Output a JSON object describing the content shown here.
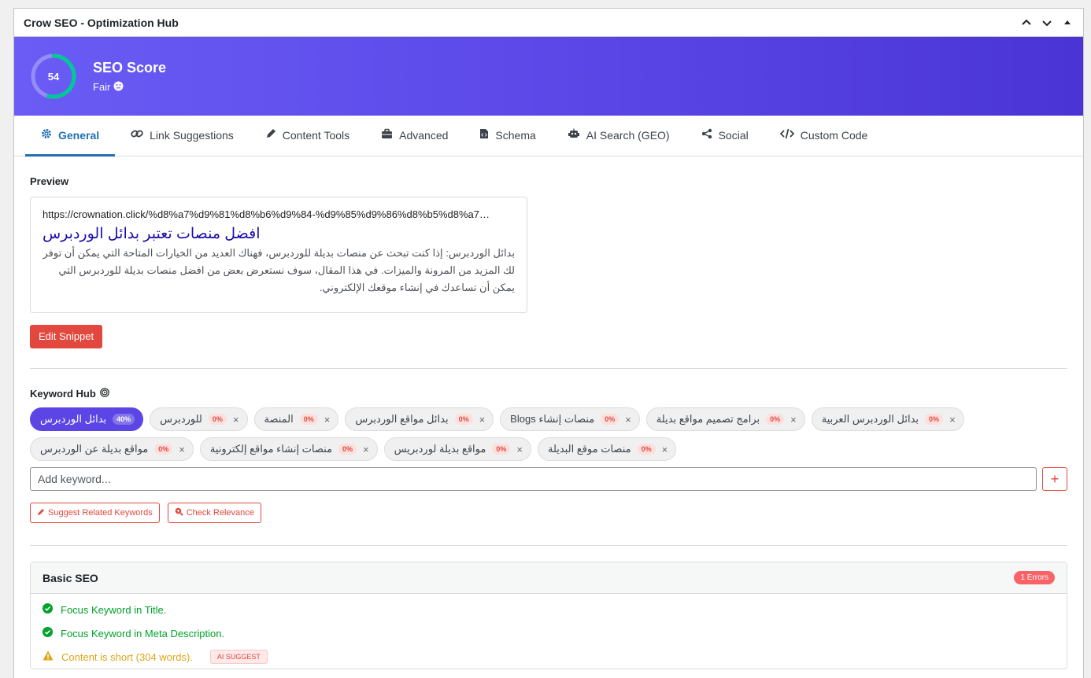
{
  "panel": {
    "title": "Crow SEO - Optimization Hub"
  },
  "score": {
    "value": "54",
    "title": "SEO Score",
    "status": "Fair",
    "percent": 54
  },
  "tabs": [
    {
      "label": "General",
      "icon": "gear-icon"
    },
    {
      "label": "Link Suggestions",
      "icon": "link-icon"
    },
    {
      "label": "Content Tools",
      "icon": "pen-icon"
    },
    {
      "label": "Advanced",
      "icon": "toolbox-icon"
    },
    {
      "label": "Schema",
      "icon": "file-code-icon"
    },
    {
      "label": "AI Search (GEO)",
      "icon": "robot-icon"
    },
    {
      "label": "Social",
      "icon": "share-icon"
    },
    {
      "label": "Custom Code",
      "icon": "code-icon"
    }
  ],
  "preview": {
    "label": "Preview",
    "url": "https://crownation.click/%d8%a7%d9%81%d8%b6%d9%84-%d9%85%d9%86%d8%b5%d8%a7…",
    "title": "افضل منصات تعتبر بدائل الوردبرس",
    "description": "بدائل الوردبرس: إذا كنت تبحث عن منصات بديلة للوردبرس، فهناك العديد من الخيارات المتاحة التي يمكن أن توفر لك المزيد من المرونة والميزات. في هذا المقال، سوف نستعرض بعض من افضل منصات بديلة للوردبرس التي يمكن أن تساعدك في إنشاء موقعك الإلكتروني."
  },
  "edit_snippet_label": "Edit Snippet",
  "keyword_hub": {
    "label": "Keyword Hub",
    "row1": [
      {
        "text": "بدائل الوردبرس",
        "pct": "40%",
        "active": true
      },
      {
        "text": "للوردبرس",
        "pct": "0%"
      },
      {
        "text": "المنصة",
        "pct": "0%"
      },
      {
        "text": "بدائل مواقع الوردبرس",
        "pct": "0%"
      },
      {
        "text": "منصات إنشاء Blogs",
        "pct": "0%"
      },
      {
        "text": "برامج تصميم مواقع بديلة",
        "pct": "0%"
      },
      {
        "text": "بدائل الوردبرس العربية",
        "pct": "0%"
      }
    ],
    "row2": [
      {
        "text": "مواقع بديلة عن الوردبرس",
        "pct": "0%"
      },
      {
        "text": "منصات إنشاء مواقع إلكترونية",
        "pct": "0%"
      },
      {
        "text": "مواقع بديلة لوردبريس",
        "pct": "0%"
      },
      {
        "text": "منصات موقع البديلة",
        "pct": "0%"
      }
    ],
    "input_placeholder": "Add keyword...",
    "add_label": "+",
    "suggest_label": "Suggest Related Keywords",
    "relevance_label": "Check Relevance"
  },
  "basic_seo": {
    "title": "Basic SEO",
    "errors_badge": "1 Errors",
    "items": [
      {
        "text": "Focus Keyword in Title.",
        "status": "ok"
      },
      {
        "text": "Focus Keyword in Meta Description.",
        "status": "ok"
      },
      {
        "text": "Content is short (304 words).",
        "status": "warn",
        "tag": "AI SUGGEST"
      }
    ]
  },
  "colors": {
    "accent": "#2271b1",
    "brand_gradient_start": "#6a5cf5",
    "brand_gradient_end": "#4a34d6",
    "danger": "#e2483d",
    "ok": "#00a32a",
    "warn": "#dba617"
  }
}
